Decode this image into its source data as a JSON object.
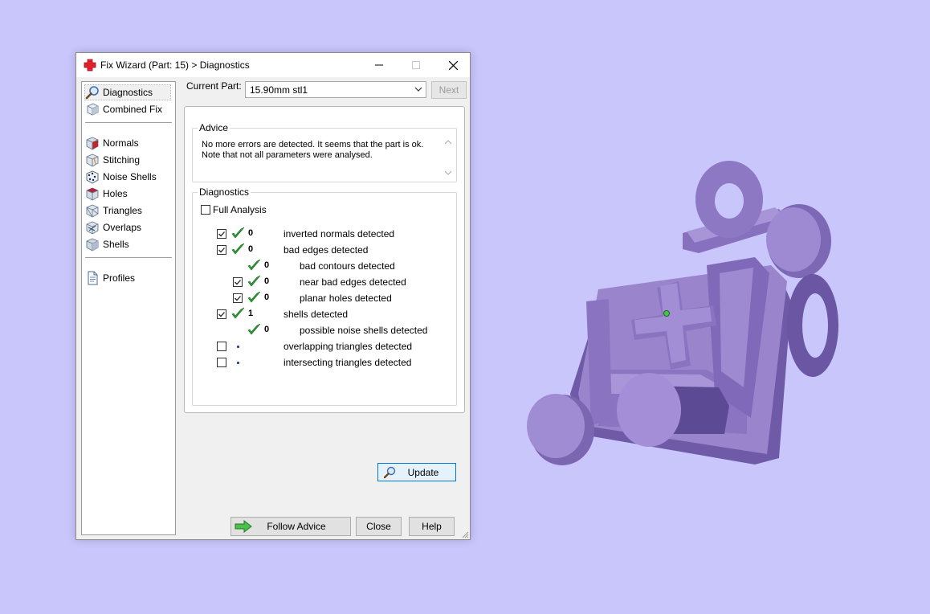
{
  "window": {
    "title": "Fix Wizard (Part: 15) > Diagnostics"
  },
  "sidebar": {
    "groups": [
      [
        {
          "label": "Diagnostics",
          "icon": "magnifier-icon",
          "selected": true
        },
        {
          "label": "Combined Fix",
          "icon": "cube-icon"
        }
      ],
      [
        {
          "label": "Normals",
          "icon": "normals-cube-icon"
        },
        {
          "label": "Stitching",
          "icon": "stitching-cube-icon"
        },
        {
          "label": "Noise Shells",
          "icon": "noise-shells-icon"
        },
        {
          "label": "Holes",
          "icon": "holes-cube-icon"
        },
        {
          "label": "Triangles",
          "icon": "triangles-cube-icon"
        },
        {
          "label": "Overlaps",
          "icon": "overlaps-cube-icon"
        },
        {
          "label": "Shells",
          "icon": "shells-cube-icon"
        }
      ],
      [
        {
          "label": "Profiles",
          "icon": "document-icon"
        }
      ]
    ]
  },
  "part_selector": {
    "label": "Current Part:",
    "value": "15.90mm stl1",
    "next_label": "Next"
  },
  "advice": {
    "title": "Advice",
    "text": "No more errors are detected. It seems that the part is ok. Note that not all parameters were analysed."
  },
  "diagnostics": {
    "title": "Diagnostics",
    "full_analysis_label": "Full Analysis",
    "full_analysis_checked": false,
    "rows": [
      {
        "checkbox": true,
        "checked": true,
        "status": "ok",
        "count": "0",
        "label": "inverted normals detected",
        "indent": 0
      },
      {
        "checkbox": true,
        "checked": true,
        "status": "ok",
        "count": "0",
        "label": "bad edges detected",
        "indent": 0
      },
      {
        "checkbox": false,
        "checked": false,
        "status": "ok",
        "count": "0",
        "label": "bad contours detected",
        "indent": 1
      },
      {
        "checkbox": true,
        "checked": true,
        "status": "ok",
        "count": "0",
        "label": "near bad edges detected",
        "indent": 1
      },
      {
        "checkbox": true,
        "checked": true,
        "status": "ok",
        "count": "0",
        "label": "planar holes detected",
        "indent": 1
      },
      {
        "checkbox": true,
        "checked": true,
        "status": "ok",
        "count": "1",
        "label": "shells detected",
        "indent": 0
      },
      {
        "checkbox": false,
        "checked": false,
        "status": "ok",
        "count": "0",
        "label": "possible noise shells detected",
        "indent": 1
      },
      {
        "checkbox": true,
        "checked": false,
        "status": "pending",
        "count": "",
        "label": "overlapping triangles detected",
        "indent": 0
      },
      {
        "checkbox": true,
        "checked": false,
        "status": "pending",
        "count": "",
        "label": "intersecting triangles detected",
        "indent": 0
      }
    ],
    "update_label": "Update"
  },
  "buttons": {
    "follow_advice": "Follow Advice",
    "close": "Close",
    "help": "Help"
  },
  "colors": {
    "background": "#c8c6fa",
    "model": "#9b86cf",
    "check": "#2e9d3a",
    "accent": "#0078d7"
  }
}
